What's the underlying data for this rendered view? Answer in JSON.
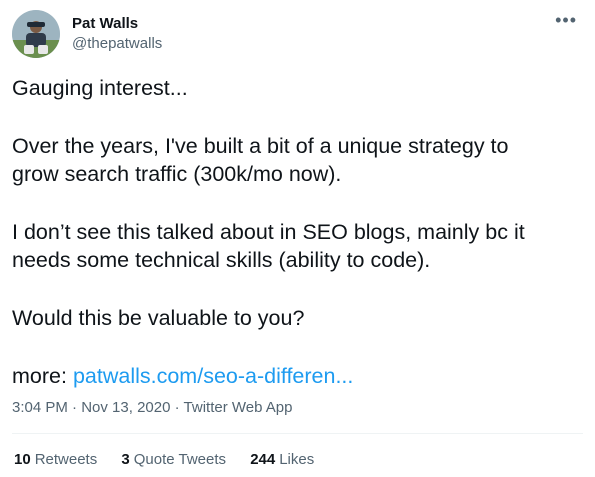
{
  "author": {
    "display_name": "Pat Walls",
    "handle": "@thepatwalls"
  },
  "more_icon": "more-horizontal-icon",
  "tweet": {
    "line1": "Gauging interest...",
    "line2a": "Over the years, I've built a bit of a unique strategy to",
    "line2b": "grow search traffic (300k/mo now).",
    "line3a": "I don’t see this talked about in SEO blogs, mainly bc it",
    "line3b": "needs some technical skills (ability to code).",
    "line4": "Would this be valuable to you?",
    "more_label": "more:",
    "link_text": "patwalls.com/seo-a-differen..."
  },
  "meta": {
    "time": "3:04 PM",
    "date": "Nov 13, 2020",
    "source": "Twitter Web App",
    "separator": "·"
  },
  "stats": {
    "retweets_count": "10",
    "retweets_label": "Retweets",
    "quotes_count": "3",
    "quotes_label": "Quote Tweets",
    "likes_count": "244",
    "likes_label": "Likes"
  },
  "colors": {
    "link": "#1d9bf0",
    "secondary_text": "#536471",
    "primary_text": "#0f1419"
  }
}
